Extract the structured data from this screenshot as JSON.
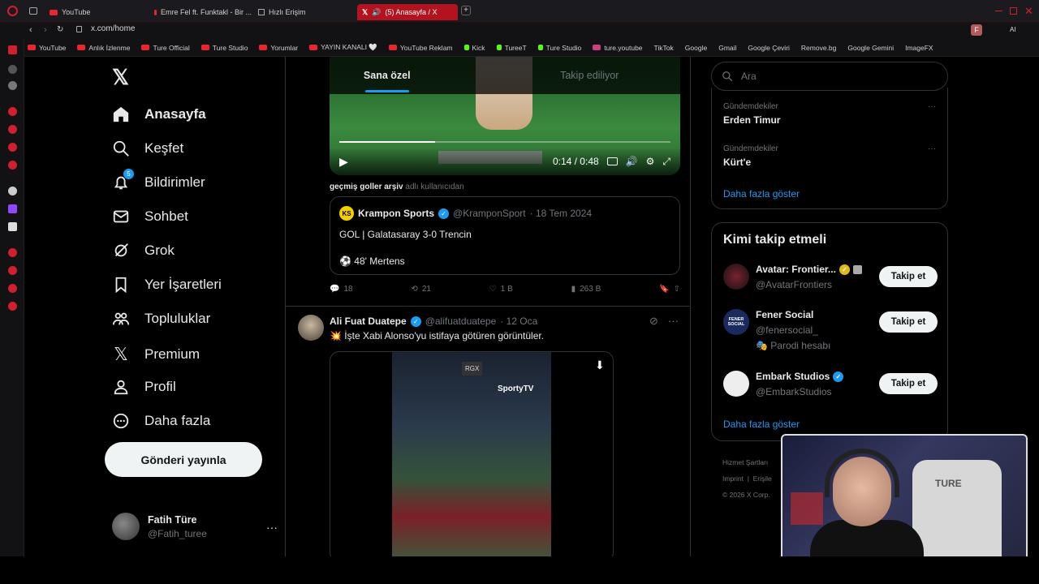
{
  "browser": {
    "tabs": [
      {
        "label": "YouTube"
      },
      {
        "label": "Emre Fel ft. Funktakl - Bir ..."
      },
      {
        "label": "Hızlı Erişim"
      },
      {
        "label": "(5) Anasayfa / X"
      }
    ],
    "url": "x.com/home",
    "toolbar_ai": "AI",
    "profile_initial": "F",
    "bookmarks": [
      "YouTube",
      "Anlık İzlenme",
      "Ture Official",
      "Ture Studio",
      "Yorumlar",
      "YAYIN KANALI 🤍",
      "YouTube Reklam",
      "Kick",
      "TureeT",
      "Ture Studio",
      "ture.youtube",
      "TikTok",
      "Google",
      "Gmail",
      "Google Çeviri",
      "Remove.bg",
      "Google Gemini",
      "ImageFX"
    ]
  },
  "nav": {
    "logo": "𝕏",
    "items": [
      "Anasayfa",
      "Keşfet",
      "Bildirimler",
      "Sohbet",
      "Grok",
      "Yer İşaretleri",
      "Topluluklar",
      "Premium",
      "Profil",
      "Daha fazla"
    ],
    "notif_count": "5",
    "post_button": "Gönderi yayınla",
    "account_name": "Fatih Türe",
    "account_handle": "@Fatih_turee",
    "account_more": "···"
  },
  "feed": {
    "tabs": [
      "Sana özel",
      "Takip ediliyor"
    ],
    "video1": {
      "time": "0:14 / 0:48",
      "progress": 0.29
    },
    "retweet_by": "geçmiş goller arşiv",
    "retweet_suffix": "adlı kullanıcıdan",
    "quote": {
      "logo": "KS",
      "name": "Krampon Sports",
      "handle": "@KramponSport",
      "date": "· 18 Tem 2024",
      "text": "GOL | Galatasaray 3-0 Trencin",
      "text2": "⚽ 48' Mertens"
    },
    "actions1": {
      "replies": "18",
      "reposts": "21",
      "likes": "1 B",
      "views": "263 B"
    },
    "post2": {
      "name": "Ali Fuat Duatepe",
      "handle": "@alifuatduatepe",
      "date": "· 12 Oca",
      "text": "💥 İşte Xabi Alonso'yu istifaya götüren görüntüler.",
      "media_badge": "RGX",
      "media_logo": "SportyTV",
      "download_icon": "⬇"
    }
  },
  "right": {
    "search_placeholder": "Ara",
    "trends": [
      {
        "context": "Gündemdekiler",
        "title": "Erden Timur"
      },
      {
        "context": "Gündemdekiler",
        "title": "Kürt'e"
      }
    ],
    "trends_more": "···",
    "show_more": "Daha fazla göster",
    "who_to_follow_title": "Kimi takip etmeli",
    "follow_label": "Takip et",
    "suggestions": [
      {
        "name": "Avatar: Frontier...",
        "handle": "@AvatarFrontiers",
        "extra": ""
      },
      {
        "name": "Fener Social",
        "handle": "@fenersocial_",
        "extra": "🎭 Parodi hesabı",
        "avatar_text": "FENER SOCIAL"
      },
      {
        "name": "Embark Studios",
        "handle": "@EmbarkStudios",
        "extra": ""
      }
    ],
    "show_more2": "Daha fazla göster",
    "footer": {
      "line1": "Hizmet Şartları",
      "line2a": "Imprint",
      "line2b": "Erişile",
      "line3": "© 2026 X Corp."
    }
  },
  "webcam": {
    "chair_text": "TURE"
  },
  "colors": {
    "accent": "#1d9bf0",
    "browser_red": "#b3121f",
    "bg": "#000000"
  }
}
